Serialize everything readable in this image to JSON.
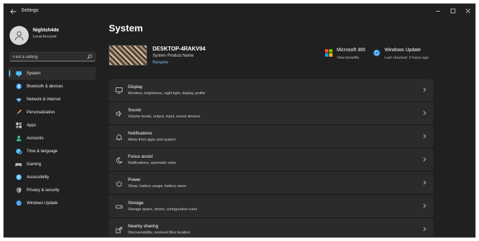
{
  "window": {
    "title": "Settings"
  },
  "account": {
    "name": "Nightsh4de",
    "type": "Local Account"
  },
  "search": {
    "placeholder": "Find a setting"
  },
  "nav": {
    "items": [
      {
        "label": "System",
        "icon": "monitor-icon",
        "active": true,
        "color": "#4cc2ff"
      },
      {
        "label": "Bluetooth & devices",
        "icon": "bluetooth-icon",
        "color": "#3b9eff"
      },
      {
        "label": "Network & internet",
        "icon": "wifi-icon",
        "color": "#6fb9e8"
      },
      {
        "label": "Personalization",
        "icon": "brush-icon",
        "color": "#f0a64a"
      },
      {
        "label": "Apps",
        "icon": "apps-icon",
        "color": "#cccccc"
      },
      {
        "label": "Accounts",
        "icon": "person-icon",
        "color": "#36c28f"
      },
      {
        "label": "Time & language",
        "icon": "globe-clock-icon",
        "color": "#4cc2ff"
      },
      {
        "label": "Gaming",
        "icon": "gamepad-icon",
        "color": "#bbbbbb"
      },
      {
        "label": "Accessibility",
        "icon": "accessibility-icon",
        "color": "#4cc2ff"
      },
      {
        "label": "Privacy & security",
        "icon": "shield-icon",
        "color": "#aaaaaa"
      },
      {
        "label": "Windows Update",
        "icon": "windows-update-icon",
        "color": "#2b88d8"
      }
    ]
  },
  "main": {
    "title": "System",
    "device": {
      "name": "DESKTOP-4RAKV94",
      "model": "System Product Name",
      "rename": "Rename"
    },
    "quick_links": [
      {
        "title": "Microsoft 365",
        "subtitle": "View benefits",
        "icon": "microsoft-logo-icon"
      },
      {
        "title": "Windows Update",
        "subtitle": "Last checked: 2 hours ago",
        "icon": "windows-update-icon"
      }
    ],
    "cards": [
      {
        "title": "Display",
        "subtitle": "Monitors, brightness, night light, display profile",
        "icon": "display-icon"
      },
      {
        "title": "Sound",
        "subtitle": "Volume levels, output, input, sound devices",
        "icon": "speaker-icon"
      },
      {
        "title": "Notifications",
        "subtitle": "Alerts from apps and system",
        "icon": "bell-icon"
      },
      {
        "title": "Focus assist",
        "subtitle": "Notifications, automatic rules",
        "icon": "moon-icon"
      },
      {
        "title": "Power",
        "subtitle": "Sleep, battery usage, battery saver",
        "icon": "power-icon"
      },
      {
        "title": "Storage",
        "subtitle": "Storage space, drives, configuration rules",
        "icon": "storage-icon"
      },
      {
        "title": "Nearby sharing",
        "subtitle": "Discoverability, received files location",
        "icon": "share-icon"
      }
    ]
  },
  "colors": {
    "background": "#202020",
    "card": "#2b2b2b",
    "accent": "#4cc2ff",
    "link": "#78c8f0"
  }
}
